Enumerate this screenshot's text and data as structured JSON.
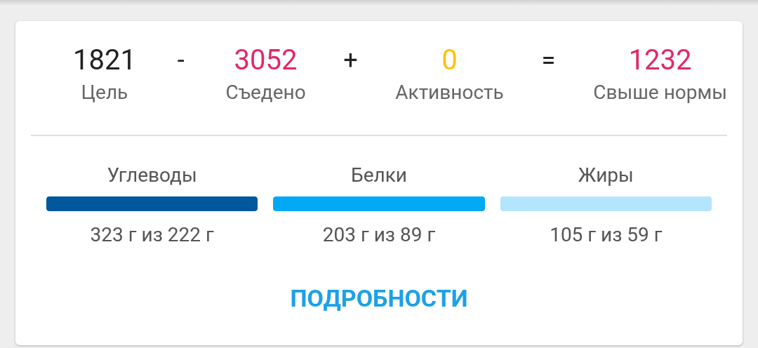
{
  "summary": [
    {
      "kind": "term",
      "value": "1821",
      "label": "Цель",
      "color": "#212121"
    },
    {
      "kind": "operator",
      "symbol": "-"
    },
    {
      "kind": "term",
      "value": "3052",
      "label": "Съедено",
      "color": "#e0286a"
    },
    {
      "kind": "operator",
      "symbol": "+"
    },
    {
      "kind": "term",
      "value": "0",
      "label": "Активность",
      "color": "#ffc107"
    },
    {
      "kind": "operator",
      "symbol": "="
    },
    {
      "kind": "term",
      "value": "1232",
      "label": "Свыше нормы",
      "color": "#e0286a"
    }
  ],
  "macros": [
    {
      "label": "Углеводы",
      "color": "#01579b",
      "level": 1,
      "amount": "323 г из 222 г"
    },
    {
      "label": "Белки",
      "color": "#03a9f4",
      "level": 1,
      "amount": "203 г из 89 г"
    },
    {
      "label": "Жиры",
      "color": "#b3e5fc",
      "level": 1,
      "amount": "105 г из 59 г"
    }
  ],
  "details_button": "ПОДРОБНОСТИ"
}
